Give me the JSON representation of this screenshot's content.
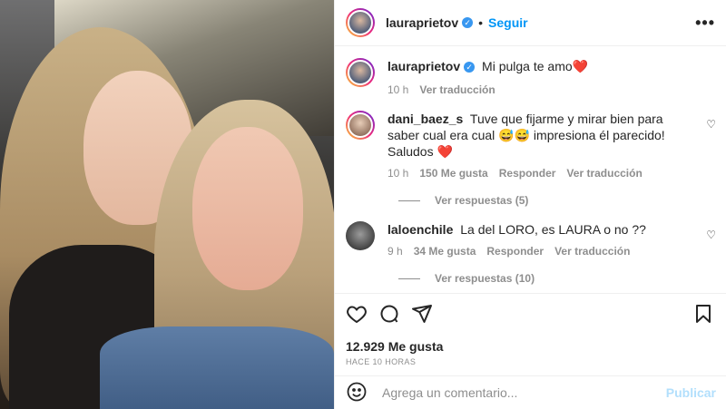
{
  "post": {
    "username": "lauraprietov",
    "follow_label": "Seguir",
    "separator": "•",
    "more_label": "•••"
  },
  "caption": {
    "username": "lauraprietov",
    "text": "Mi pulga te amo❤️",
    "time": "10 h",
    "translate": "Ver traducción"
  },
  "comments": [
    {
      "username": "dani_baez_s",
      "text": "Tuve que fijarme y mirar bien para saber cual era cual 😅😅 impresiona él parecido! Saludos ❤️",
      "time": "10 h",
      "likes": "150 Me gusta",
      "reply": "Responder",
      "translate": "Ver traducción",
      "replies": "Ver respuestas (5)"
    },
    {
      "username": "laloenchile",
      "text": "La del LORO, es LAURA o no ??",
      "time": "9 h",
      "likes": "34 Me gusta",
      "reply": "Responder",
      "translate": "Ver traducción",
      "replies": "Ver respuestas (10)"
    }
  ],
  "footer": {
    "likes": "12.929 Me gusta",
    "ago": "HACE 10 HORAS",
    "comment_placeholder": "Agrega un comentario...",
    "post_label": "Publicar"
  },
  "colors": {
    "accent": "#0095f6",
    "verified": "#3897f0",
    "muted": "#8e8e8e"
  },
  "icons": [
    "heart-icon",
    "comment-icon",
    "share-icon",
    "bookmark-icon",
    "emoji-icon",
    "verified-icon",
    "more-icon"
  ]
}
